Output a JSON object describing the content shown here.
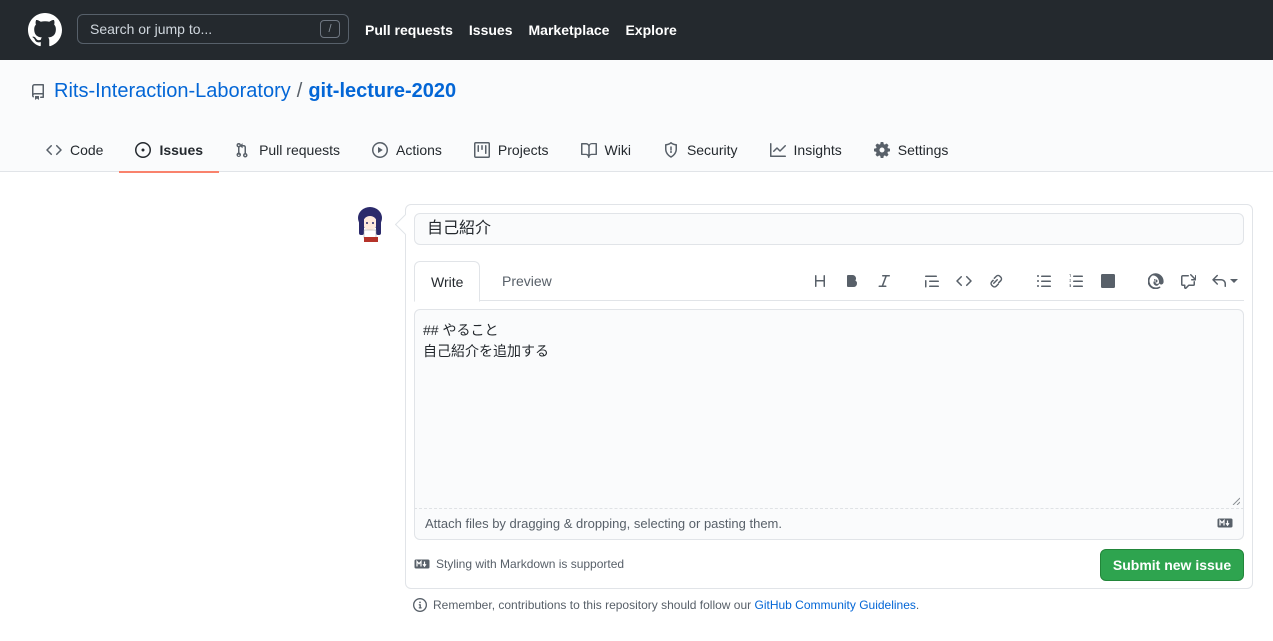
{
  "header": {
    "search_placeholder": "Search or jump to...",
    "search_shortcut": "/",
    "nav": [
      "Pull requests",
      "Issues",
      "Marketplace",
      "Explore"
    ]
  },
  "repo": {
    "owner": "Rits-Interaction-Laboratory",
    "separator": "/",
    "name": "git-lecture-2020",
    "tabs": [
      {
        "label": "Code",
        "icon": "code-icon"
      },
      {
        "label": "Issues",
        "icon": "issue-opened-icon",
        "selected": true
      },
      {
        "label": "Pull requests",
        "icon": "git-pull-request-icon"
      },
      {
        "label": "Actions",
        "icon": "play-icon"
      },
      {
        "label": "Projects",
        "icon": "project-icon"
      },
      {
        "label": "Wiki",
        "icon": "book-icon"
      },
      {
        "label": "Security",
        "icon": "shield-icon"
      },
      {
        "label": "Insights",
        "icon": "graph-icon"
      },
      {
        "label": "Settings",
        "icon": "gear-icon"
      }
    ]
  },
  "issue_form": {
    "title_value": "自己紹介",
    "write_tab": "Write",
    "preview_tab": "Preview",
    "body_lines": [
      "## やること",
      "自己紹介を追加する"
    ],
    "attach_hint": "Attach files by dragging & dropping, selecting or pasting them.",
    "markdown_note": "Styling with Markdown is supported",
    "submit_label": "Submit new issue"
  },
  "footer": {
    "remember_text": "Remember, contributions to this repository should follow our ",
    "guidelines_link": "GitHub Community Guidelines",
    "period": "."
  },
  "colors": {
    "header_bg": "#24292e",
    "link": "#0366d6",
    "tab_underline": "#f9826c",
    "submit_bg": "#2ea44f"
  }
}
